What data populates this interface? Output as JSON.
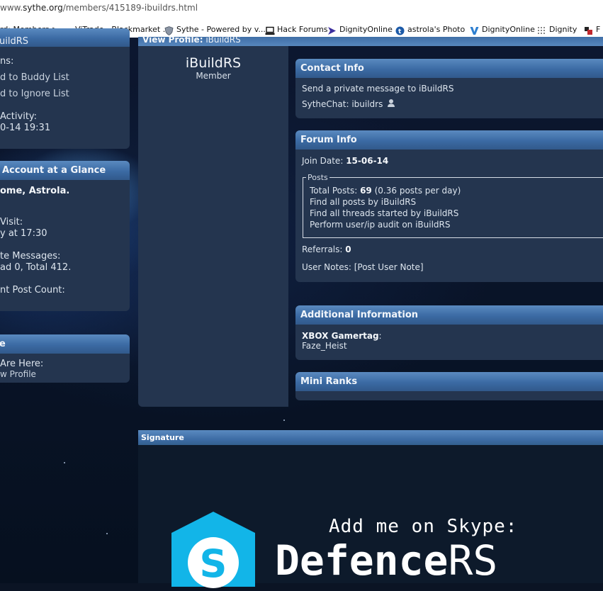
{
  "browser": {
    "url_prefix": "www.",
    "url_host": "sythe.org",
    "url_path": "/members/415189-ibuildrs.html",
    "bookmarks": [
      {
        "label": "rd: Members > ..."
      },
      {
        "label": "ViTrade - Blackmarket ..."
      },
      {
        "label": "Sythe - Powered by v..."
      },
      {
        "label": "Hack Forums"
      },
      {
        "label": "DignityOnline"
      },
      {
        "label": "astrola's Photo"
      },
      {
        "label": "DignityOnline"
      },
      {
        "label": "Dignity"
      },
      {
        "label": "F"
      }
    ]
  },
  "sidebar": {
    "top_panel_header": "uildRS",
    "actions_label": "ns:",
    "buddy_link": "d to Buddy List",
    "ignore_link": "d to Ignore List",
    "activity_label": "Activity:",
    "activity_value": "0-14 19:31",
    "glance_header": "Account at a Glance",
    "welcome": "ome, Astrola.",
    "visit_label": "Visit:",
    "visit_value": "y at 17:30",
    "messages_label": "te Messages:",
    "messages_value": "ad 0, Total 412.",
    "postcount_label": "nt Post Count:",
    "here_header": "e",
    "here_label": "Are Here:",
    "here_value": "w Profile"
  },
  "profile": {
    "view_header_label": "View Profile:",
    "view_header_user": "iBuildRS",
    "username": "iBuildRS",
    "usertitle": "Member"
  },
  "contact": {
    "header": "Contact Info",
    "pm_link": "Send a private message to iBuildRS",
    "sythechat_label": "SytheChat:",
    "sythechat_value": "ibuildrs"
  },
  "forum": {
    "header": "Forum Info",
    "join_label": "Join Date:",
    "join_value": "15-06-14",
    "posts_legend": "Posts",
    "total_label": "Total Posts:",
    "total_value": "69",
    "total_rate": "(0.36 posts per day)",
    "find_posts": "Find all posts by iBuildRS",
    "find_threads": "Find all threads started by iBuildRS",
    "audit": "Perform user/ip audit on iBuildRS",
    "referrals_label": "Referrals:",
    "referrals_value": "0",
    "notes_label": "User Notes:",
    "notes_link": "[Post User Note]"
  },
  "additional": {
    "header": "Additional Information",
    "gamertag_label": "XBOX Gamertag",
    "gamertag_colon": ":",
    "gamertag_value": "Faze_Heist"
  },
  "miniranks": {
    "header": "Mini Ranks"
  },
  "signature": {
    "header": "Signature",
    "line1": "Add me on Skype:",
    "line2_bold": "Defence",
    "line2_light": "RS",
    "logo_letter": "S",
    "skype_color": "#12b5e8"
  }
}
